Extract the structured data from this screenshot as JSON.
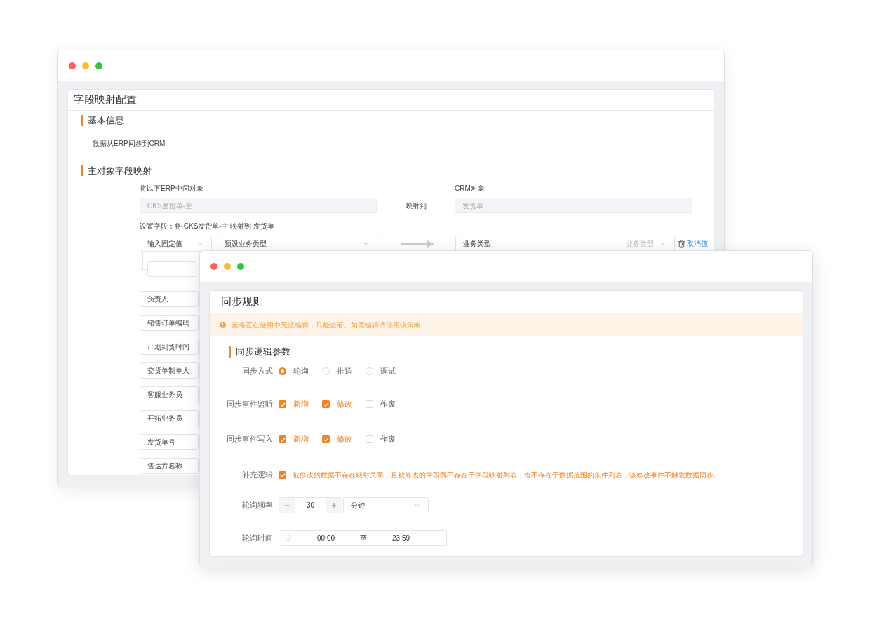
{
  "back_window": {
    "title": "字段映射配置",
    "basic_info": {
      "heading": "基本信息",
      "text": "数据从ERP同步到CRM"
    },
    "main_mapping": {
      "heading": "主对象字段映射",
      "source_label": "将以下ERP中间对象",
      "source_value": "CKS发货单-主",
      "map_to": "映射到",
      "target_label": "CRM对象",
      "target_value": "发货单",
      "set_fields": "设置字段：将 CKS发货单-主 映射到 发货单",
      "source_type": "输入固定值",
      "source_field": "预设业务类型",
      "target_field": {
        "value": "业务类型",
        "hint": "业务类型"
      },
      "cancel_link": "取消值"
    },
    "fields": [
      "负责人",
      "销售订单编码",
      "计划到货时间",
      "交货单制单人",
      "客服业务员",
      "开拓业务员",
      "发货单号",
      "售达方名称"
    ]
  },
  "front_window": {
    "title": "同步规则",
    "alert": "策略正在使用中无法编辑，只能查看。如需编辑请停用该策略",
    "section_heading": "同步逻辑参数",
    "sync_mode": {
      "label": "同步方式",
      "options": [
        {
          "label": "轮询",
          "selected": true
        },
        {
          "label": "推送",
          "selected": false
        },
        {
          "label": "调试",
          "selected": false
        }
      ]
    },
    "event_listen": {
      "label": "同步事件监听",
      "options": [
        {
          "label": "新增",
          "checked": true
        },
        {
          "label": "修改",
          "checked": true
        },
        {
          "label": "作废",
          "checked": false
        }
      ]
    },
    "event_write": {
      "label": "同步事件写入",
      "options": [
        {
          "label": "新增",
          "checked": true
        },
        {
          "label": "修改",
          "checked": true
        },
        {
          "label": "作废",
          "checked": false
        }
      ]
    },
    "supplement": {
      "label": "补充逻辑",
      "checked": true,
      "text": "被修改的数据不存在映射关系，且被修改的字段既不存在于字段映射列表，也不存在于数据范围的条件列表，该修改事件不触发数据同步。"
    },
    "frequency": {
      "label": "轮询频率",
      "value": "30",
      "unit": "分钟"
    },
    "time": {
      "label": "轮询时间",
      "start": "00:00",
      "separator": "至",
      "end": "23:59"
    }
  }
}
